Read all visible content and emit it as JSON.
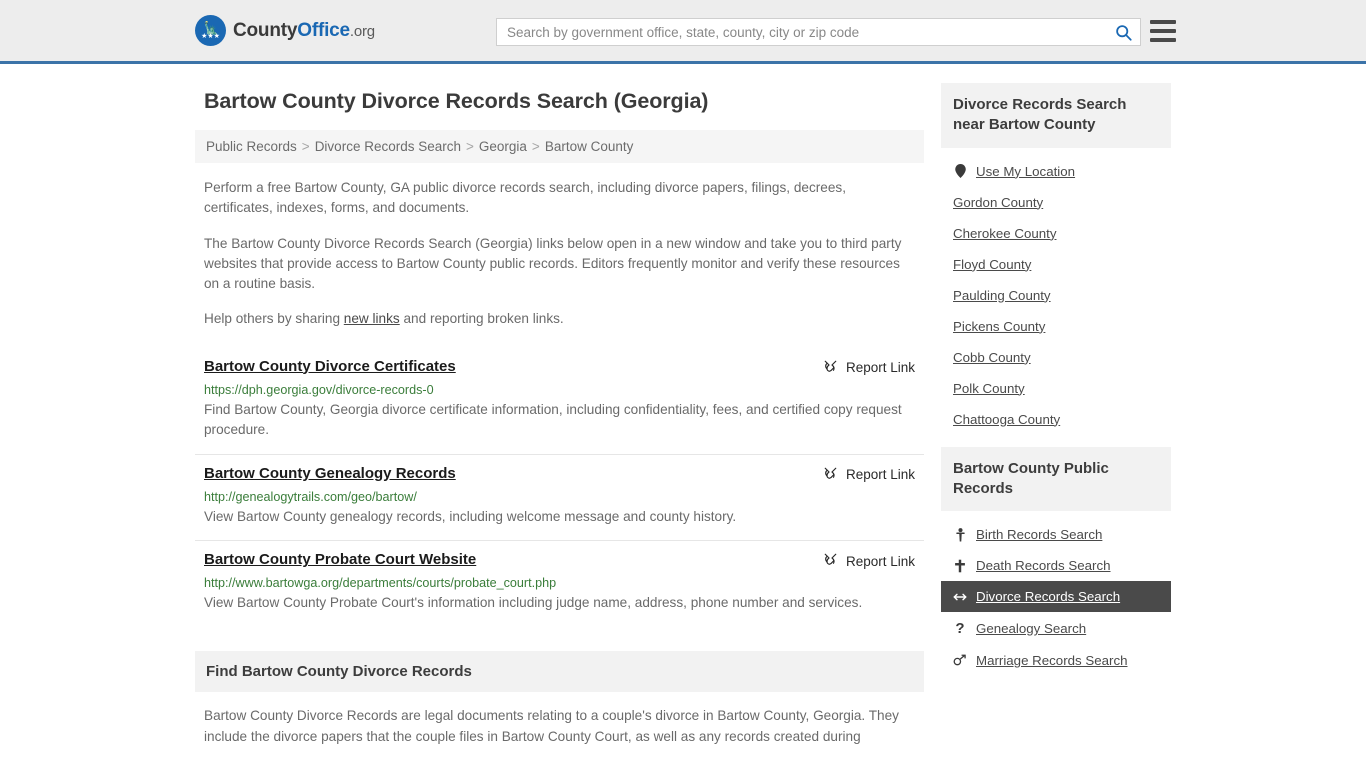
{
  "header": {
    "brand_county": "County",
    "brand_office": "Office",
    "brand_tld": ".org",
    "search_placeholder": "Search by government office, state, county, city or zip code",
    "search_value": "",
    "search_icon": "search-icon",
    "menu_icon": "hamburger-menu-icon",
    "accent_color": "#3b73a8"
  },
  "page_title": "Bartow County Divorce Records Search (Georgia)",
  "breadcrumb": {
    "separator": ">",
    "items": [
      {
        "label": "Public Records"
      },
      {
        "label": "Divorce Records Search"
      },
      {
        "label": "Georgia"
      },
      {
        "label": "Bartow County"
      }
    ]
  },
  "intro": {
    "p1": "Perform a free Bartow County, GA public divorce records search, including divorce papers, filings, decrees, certificates, indexes, forms, and documents.",
    "p2": "The Bartow County Divorce Records Search (Georgia) links below open in a new window and take you to third party websites that provide access to Bartow County public records. Editors frequently monitor and verify these resources on a routine basis.",
    "p3_before": "Help others by sharing ",
    "p3_link": "new links",
    "p3_after": " and reporting broken links."
  },
  "results": {
    "report_label": "Report Link",
    "report_icon": "broken-link-icon",
    "items": [
      {
        "title": "Bartow County Divorce Certificates",
        "url": "https://dph.georgia.gov/divorce-records-0",
        "desc": "Find Bartow County, Georgia divorce certificate information, including confidentiality, fees, and certified copy request procedure."
      },
      {
        "title": "Bartow County Genealogy Records",
        "url": "http://genealogytrails.com/geo/bartow/",
        "desc": "View Bartow County genealogy records, including welcome message and county history."
      },
      {
        "title": "Bartow County Probate Court Website",
        "url": "http://www.bartowga.org/departments/courts/probate_court.php",
        "desc": "View Bartow County Probate Court's information including judge name, address, phone number and services."
      }
    ]
  },
  "find_section": {
    "heading": "Find Bartow County Divorce Records",
    "body": "Bartow County Divorce Records are legal documents relating to a couple's divorce in Bartow County, Georgia. They include the divorce papers that the couple files in Bartow County Court, as well as any records created during"
  },
  "sidebar": {
    "nearby": {
      "heading": "Divorce Records Search near Bartow County",
      "items": [
        {
          "label": "Use My Location",
          "icon": "map-pin-icon"
        },
        {
          "label": "Gordon County",
          "icon": ""
        },
        {
          "label": "Cherokee County",
          "icon": ""
        },
        {
          "label": "Floyd County",
          "icon": ""
        },
        {
          "label": "Paulding County",
          "icon": ""
        },
        {
          "label": "Pickens County",
          "icon": ""
        },
        {
          "label": "Cobb County",
          "icon": ""
        },
        {
          "label": "Polk County",
          "icon": ""
        },
        {
          "label": "Chattooga County",
          "icon": ""
        }
      ]
    },
    "public_records": {
      "heading": "Bartow County Public Records",
      "active_color": "#4a4a4a",
      "items": [
        {
          "label": "Birth Records Search",
          "icon": "baby-icon",
          "glyph": "Ɣ",
          "active": false
        },
        {
          "label": "Death Records Search",
          "icon": "cross-icon",
          "glyph": "✚",
          "active": false
        },
        {
          "label": "Divorce Records Search",
          "icon": "left-right-arrow-icon",
          "glyph": "↔",
          "active": true
        },
        {
          "label": "Genealogy Search",
          "icon": "question-mark-icon",
          "glyph": "?",
          "active": false
        },
        {
          "label": "Marriage Records Search",
          "icon": "male-female-icon",
          "glyph": "⚤",
          "active": false
        }
      ]
    }
  }
}
